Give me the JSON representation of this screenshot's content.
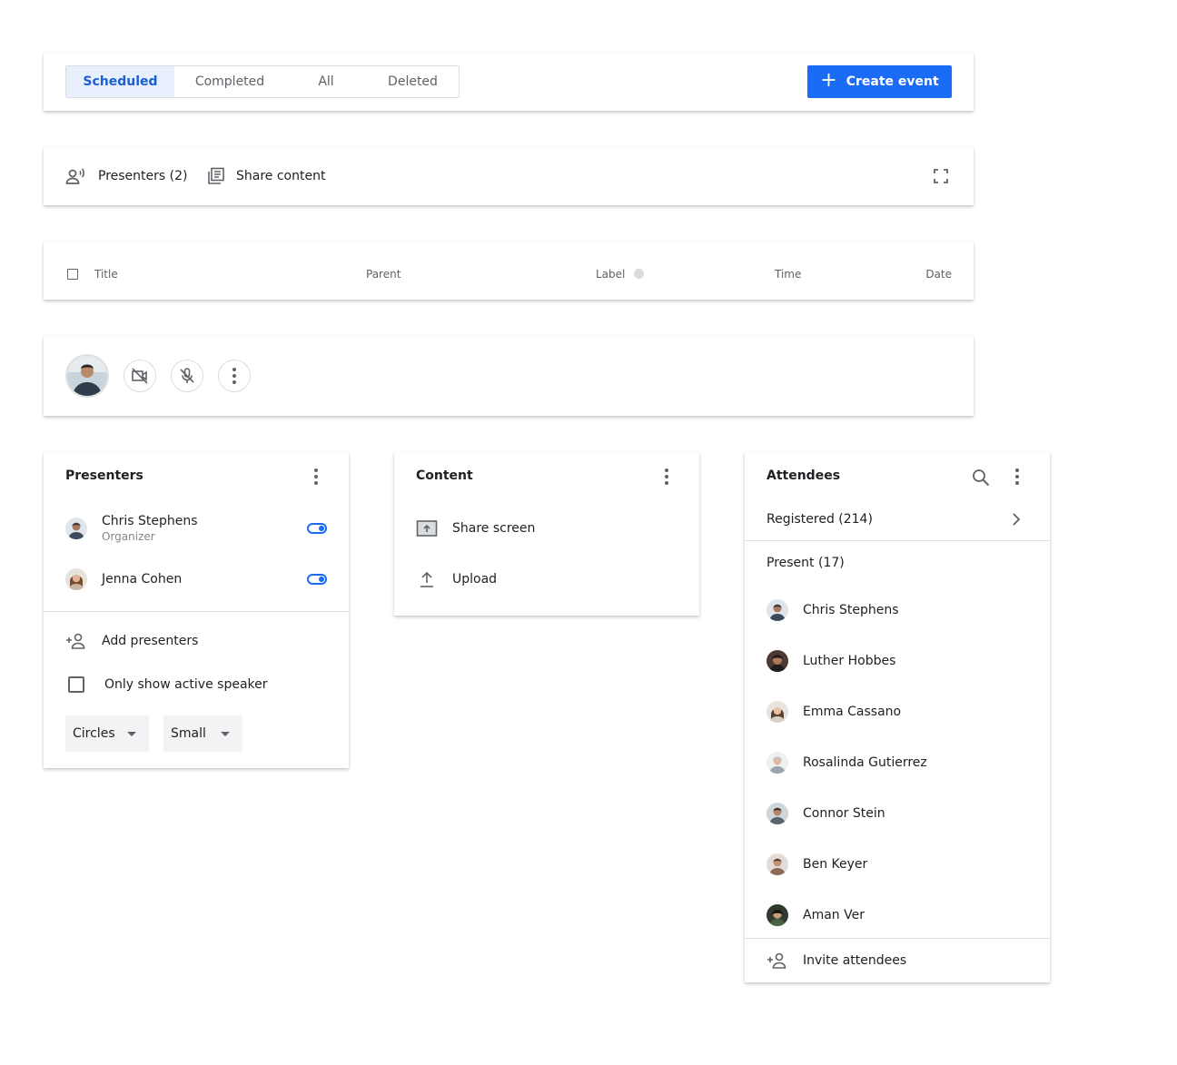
{
  "tabs": {
    "items": [
      {
        "label": "Scheduled",
        "active": true
      },
      {
        "label": "Completed",
        "active": false
      },
      {
        "label": "All",
        "active": false
      },
      {
        "label": "Deleted",
        "active": false
      }
    ],
    "create_button": "Create event",
    "accent_color": "#1a6bf5"
  },
  "share_bar": {
    "presenters": "Presenters (2)",
    "share_content": "Share content"
  },
  "table_header": {
    "columns": [
      "Title",
      "Parent",
      "Label",
      "Time",
      "Date"
    ]
  },
  "controls": {
    "icons": [
      "avatar",
      "video-off-icon",
      "mic-off-icon",
      "more-vert-icon"
    ]
  },
  "presenters_panel": {
    "title": "Presenters",
    "people": [
      {
        "name": "Chris Stephens",
        "role": "Organizer",
        "enabled": true
      },
      {
        "name": "Jenna Cohen",
        "role": "",
        "enabled": true
      }
    ],
    "add_label": "Add presenters",
    "active_speaker_label": "Only show active speaker",
    "layout_select": "Circles",
    "size_select": "Small"
  },
  "content_panel": {
    "title": "Content",
    "items": [
      {
        "label": "Share screen",
        "icon": "present-to-all-icon"
      },
      {
        "label": "Upload",
        "icon": "upload-icon"
      }
    ]
  },
  "attendees_panel": {
    "title": "Attendees",
    "registered": "Registered (214)",
    "present": "Present (17)",
    "people": [
      "Chris Stephens",
      "Luther Hobbes",
      "Emma Cassano",
      "Rosalinda Gutierrez",
      "Connor Stein",
      "Ben Keyer",
      "Aman Ver"
    ],
    "invite_label": "Invite attendees"
  }
}
